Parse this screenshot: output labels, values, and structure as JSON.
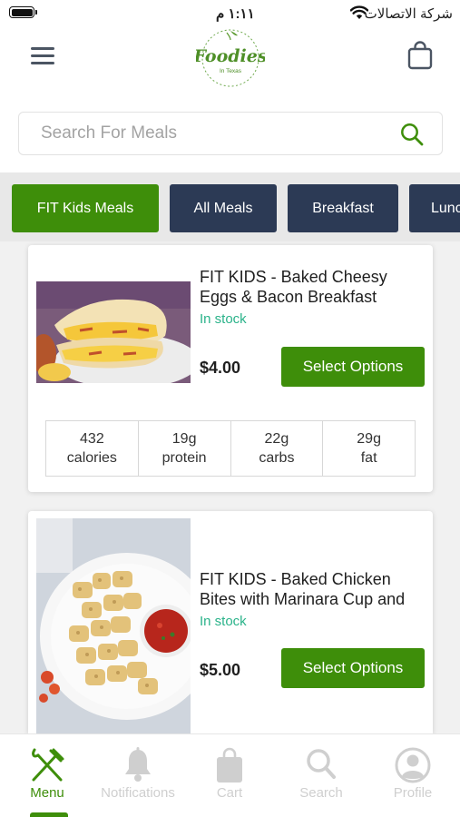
{
  "status_bar": {
    "time": "١:١١ م",
    "carrier": "شركة الاتصالات"
  },
  "header": {
    "logo_text": "Foodies",
    "logo_subtext": "In Texas"
  },
  "search": {
    "placeholder": "Search For Meals",
    "value": ""
  },
  "categories": [
    {
      "label": "FIT Kids Meals",
      "active": true
    },
    {
      "label": "All Meals",
      "active": false
    },
    {
      "label": "Breakfast",
      "active": false
    },
    {
      "label": "Lunch",
      "active": false
    }
  ],
  "products": [
    {
      "title": "FIT KIDS - Baked Cheesy Eggs & Bacon Breakfast",
      "stock": "In stock",
      "price": "$4.00",
      "button": "Select Options",
      "nutrition": [
        {
          "value": "432",
          "unit": "calories"
        },
        {
          "value": "19g",
          "unit": "protein"
        },
        {
          "value": "22g",
          "unit": "carbs"
        },
        {
          "value": "29g",
          "unit": "fat"
        }
      ]
    },
    {
      "title": "FIT KIDS - Baked Chicken Bites with Marinara Cup and",
      "stock": "In stock",
      "price": "$5.00",
      "button": "Select Options"
    }
  ],
  "bottom_nav": [
    {
      "label": "Menu",
      "icon": "fork-knife-icon",
      "active": true
    },
    {
      "label": "Notifications",
      "icon": "bell-icon",
      "active": false
    },
    {
      "label": "Cart",
      "icon": "shopping-bag-icon",
      "active": false
    },
    {
      "label": "Search",
      "icon": "search-icon",
      "active": false
    },
    {
      "label": "Profile",
      "icon": "profile-icon",
      "active": false
    }
  ],
  "colors": {
    "brand_green": "#3e8e0a",
    "tab_dark": "#2c3a55",
    "stock_teal": "#2bb38a",
    "nav_inactive": "#cfcfcf"
  }
}
